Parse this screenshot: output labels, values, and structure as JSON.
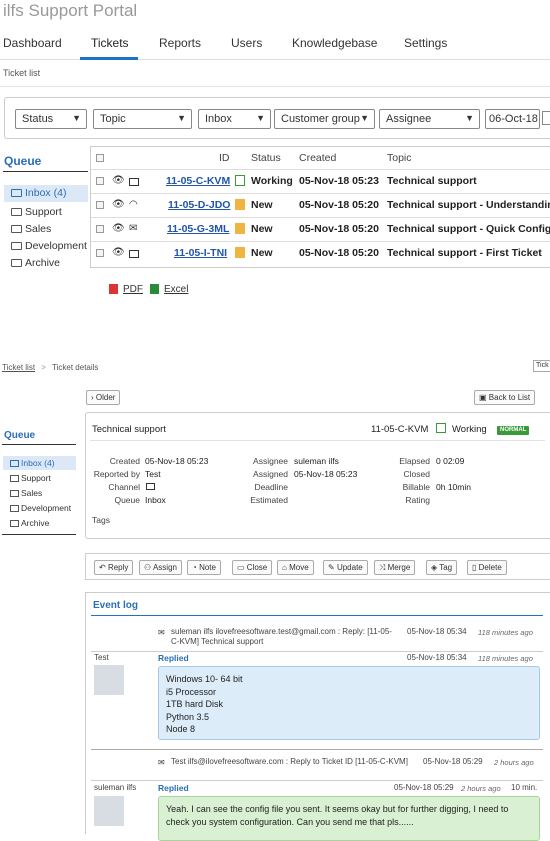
{
  "app": {
    "title": "ilfs Support Portal"
  },
  "nav": {
    "items": [
      "Dashboard",
      "Tickets",
      "Reports",
      "Users",
      "Knowledgebase",
      "Settings"
    ],
    "active": "Tickets"
  },
  "breadcrumb_list": "Ticket list",
  "filters": {
    "status": "Status",
    "topic": "Topic",
    "inbox": "Inbox",
    "customer_group": "Customer group",
    "assignee": "Assignee",
    "date": "06-Oct-18"
  },
  "queue": {
    "title": "Queue",
    "items": [
      "Inbox (4)",
      "Support",
      "Sales",
      "Development",
      "Archive"
    ],
    "active": "Inbox (4)"
  },
  "table": {
    "headers": [
      "ID",
      "Status",
      "Created",
      "Topic"
    ],
    "rows": [
      {
        "id": "11-05-C-KVM",
        "status": "Working",
        "created": "05-Nov-18 05:23",
        "topic": "Technical support",
        "status_color": "#3a9a3a"
      },
      {
        "id": "11-05-D-JDO",
        "status": "New",
        "created": "05-Nov-18 05:20",
        "topic": "Technical support - Understanding",
        "status_color": "#f0b440"
      },
      {
        "id": "11-05-G-3ML",
        "status": "New",
        "created": "05-Nov-18 05:20",
        "topic": "Technical support - Quick Configura",
        "status_color": "#f0b440"
      },
      {
        "id": "11-05-I-TNI",
        "status": "New",
        "created": "05-Nov-18 05:20",
        "topic": "Technical support - First Ticket",
        "status_color": "#f0b440"
      }
    ]
  },
  "export": {
    "pdf": "PDF",
    "excel": "Excel"
  },
  "details": {
    "breadcrumb": {
      "list": "Ticket list",
      "separator": ">",
      "current": "Ticket details",
      "edge": "Tick"
    },
    "older": "Older",
    "back": "Back to List",
    "topic": "Technical support",
    "id": "11-05-C-KVM",
    "status": "Working",
    "badge": "NORMAL",
    "fields_left": [
      {
        "label": "Created",
        "value": "05-Nov-18 05:23"
      },
      {
        "label": "Reported by",
        "value": "Test"
      },
      {
        "label": "Channel",
        "value": ""
      },
      {
        "label": "Queue",
        "value": "Inbox"
      }
    ],
    "fields_mid": [
      {
        "label": "Assignee",
        "value": "suleman ilfs"
      },
      {
        "label": "Assigned",
        "value": "05-Nov-18 05:23"
      },
      {
        "label": "Deadline",
        "value": ""
      },
      {
        "label": "Estimated",
        "value": ""
      }
    ],
    "fields_right": [
      {
        "label": "Elapsed",
        "value": "0 02:09"
      },
      {
        "label": "Closed",
        "value": ""
      },
      {
        "label": "Billable",
        "value": "0h 10min"
      },
      {
        "label": "Rating",
        "value": ""
      }
    ],
    "tags_label": "Tags",
    "actions": [
      "Reply",
      "Assign",
      "Note",
      "Close",
      "Move",
      "Update",
      "Merge",
      "Tag",
      "Delete"
    ],
    "event_log": {
      "title": "Event log",
      "events": [
        {
          "header": "suleman ilfs ilovefreesoftware.test@gmail.com : Reply: [11-05-C-KVM] Technical support",
          "header_time": "05-Nov-18 05:34",
          "header_ago": "118 minutes ago",
          "author": "Test",
          "action": "Replied",
          "time": "05-Nov-18 05:34",
          "ago": "118 minutes ago",
          "body": [
            "Windows 10- 64 bit",
            "i5 Processor",
            "1TB hard Disk",
            "Python 3.5",
            "Node 8"
          ]
        },
        {
          "header": "Test ilfs@ilovefreesoftware.com : Reply to Ticket ID [11-05-C-KVM]",
          "header_time": "05-Nov-18 05:29",
          "header_ago": "2 hours ago",
          "author": "suleman ilfs",
          "action": "Replied",
          "time": "05-Nov-18 05:29",
          "ago": "2 hours ago",
          "extra": "10 min.",
          "body": [
            "Yeah. I can see the config file you sent. It seems okay but for further digging, I need to check you system configuration. Can you send me that pls......"
          ]
        }
      ]
    }
  }
}
